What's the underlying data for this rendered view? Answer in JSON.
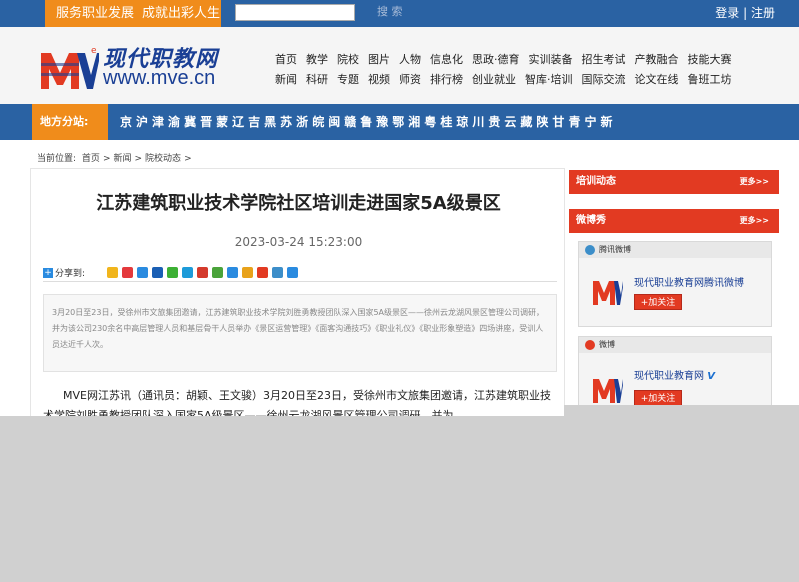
{
  "topbar": {
    "slogan_1": "服务职业发展",
    "slogan_2": "成就出彩人生",
    "search_button": "搜 索",
    "login": "登录",
    "separator": "|",
    "register": "注册"
  },
  "logo": {
    "name": "现代职教网",
    "url": "www.mve.cn"
  },
  "nav": {
    "row1": [
      "首页",
      "教学",
      "院校",
      "图片",
      "人物",
      "信息化",
      "思政·德育",
      "实训装备",
      "招生考试",
      "产教融合",
      "技能大赛"
    ],
    "row2": [
      "新闻",
      "科研",
      "专题",
      "视频",
      "师资",
      "排行榜",
      "创业就业",
      "智库·培训",
      "国际交流",
      "论文在线",
      "鲁班工坊"
    ]
  },
  "branches": {
    "label": "地方分站:",
    "items": [
      "京",
      "沪",
      "津",
      "渝",
      "冀",
      "晋",
      "蒙",
      "辽",
      "吉",
      "黑",
      "苏",
      "浙",
      "皖",
      "闽",
      "赣",
      "鲁",
      "豫",
      "鄂",
      "湘",
      "粤",
      "桂",
      "琼",
      "川",
      "贵",
      "云",
      "藏",
      "陕",
      "甘",
      "青",
      "宁",
      "新"
    ]
  },
  "breadcrumb": {
    "label": "当前位置:",
    "items": [
      "首页",
      ">",
      "新闻",
      ">",
      "院校动态",
      ">"
    ]
  },
  "article": {
    "title": "江苏建筑职业技术学院社区培训走进国家5A级景区",
    "date": "2023-03-24 15:23:00",
    "share_label": "分享到:",
    "summary": "3月20日至23日，受徐州市文旅集团邀请，江苏建筑职业技术学院刘胜勇教授团队深入国家5A级景区——徐州云龙湖风景区管理公司调研，并为该公司230余名中高层管理人员和基层骨干人员举办《景区运营管理》《面客沟通技巧》《职业礼仪》《职业形象塑造》四场讲座，受训人员达近千人次。",
    "body": "MVE网江苏讯（通讯员：胡颖、王文骏）3月20日至23日，受徐州市文旅集团邀请，江苏建筑职业技术学院刘胜勇教授团队深入国家5A级景区——徐州云龙湖风景区管理公司调研，并为"
  },
  "share_icons": [
    "#f1b51c",
    "#e4393c",
    "#2a8be0",
    "#1a5fb4",
    "#3cb034",
    "#1d9bd9",
    "#d43a2c",
    "#4aa33a",
    "#2a8be0",
    "#e8a21a",
    "#e23a22",
    "#3c8ec9",
    "#2a8be0"
  ],
  "sidebar": {
    "panel1": {
      "title": "培训动态",
      "more": "更多>>"
    },
    "panel2": {
      "title": "微博秀",
      "more": "更多>>"
    },
    "tencent": {
      "head": "腾讯微博",
      "name": "现代职业教育网腾讯微博",
      "follow": "+加关注"
    },
    "sina": {
      "head": "微博",
      "name": "现代职业教育网",
      "follow": "+加关注"
    }
  },
  "colors": {
    "brand_blue": "#2a62a3",
    "accent_orange": "#f08c1b",
    "panel_red": "#e23a22"
  }
}
